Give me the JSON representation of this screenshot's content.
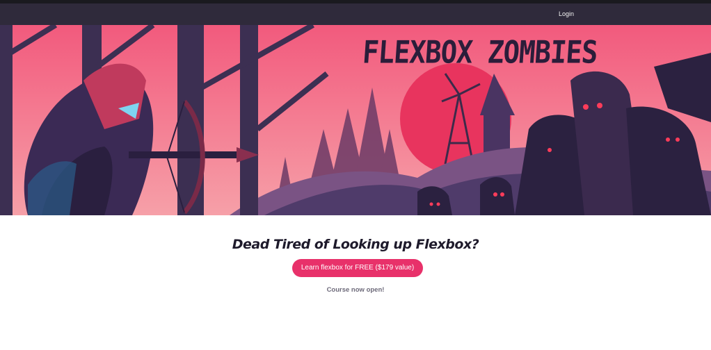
{
  "nav": {
    "login_label": "Login"
  },
  "hero": {
    "title": "FLEXBOX ZOMBIES",
    "colors": {
      "sky": "#f0567a",
      "moon": "#e8345e",
      "dark": "#2a2140",
      "purple": "#4a3a66"
    }
  },
  "main": {
    "headline": "Dead Tired of Looking up Flexbox?",
    "cta_label": "Learn flexbox for FREE ($179 value)",
    "note": "Course now open!"
  },
  "colors": {
    "navbar": "#2f2a3b",
    "accent": "#e8316a",
    "note": "#6d6a7a"
  }
}
